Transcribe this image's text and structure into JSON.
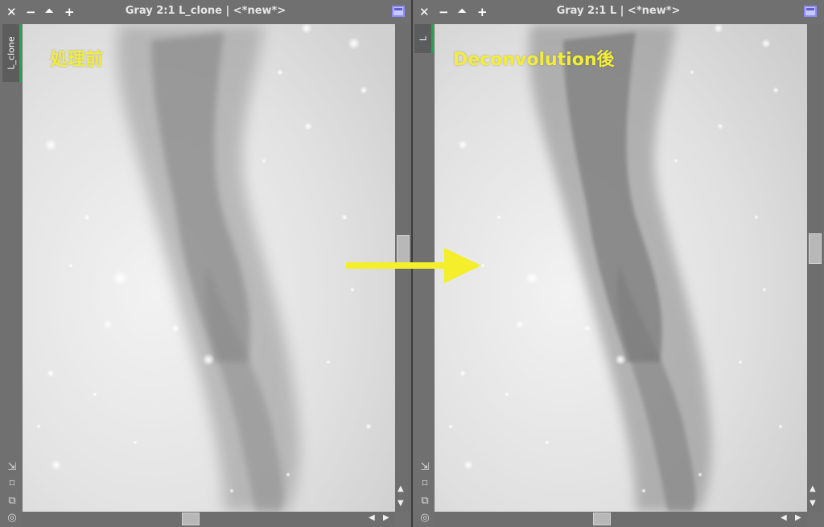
{
  "left_window": {
    "title": "Gray 2:1 L_clone | <*new*>",
    "tab_label": "L_clone",
    "caption": "処理前"
  },
  "right_window": {
    "title": "Gray 2:1 L | <*new*>",
    "tab_label": "L",
    "caption": "Deconvolution後"
  },
  "titlebar_buttons": {
    "close": "✕",
    "minimize": "−",
    "maximize": "⏶",
    "add": "+"
  },
  "side_icons": [
    "resize-diagonal-icon",
    "fit-icon",
    "clone-icon",
    "target-icon"
  ],
  "colors": {
    "caption": "#f2ed3c",
    "arrow": "#f4ef2a",
    "tab_accent": "#23a55a",
    "shade_button": "#8c8cff"
  }
}
